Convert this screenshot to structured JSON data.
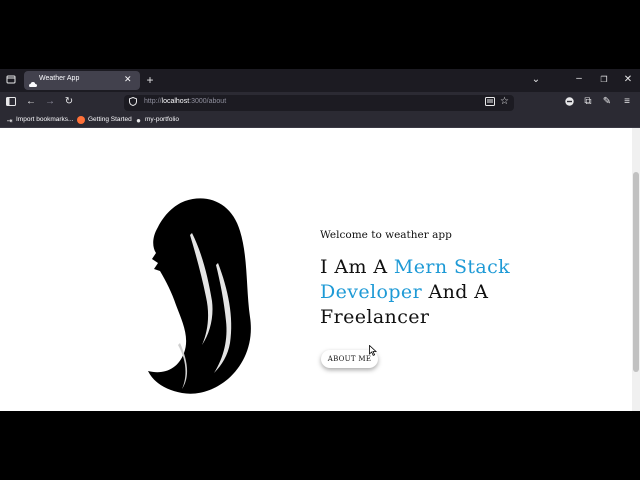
{
  "browser": {
    "tab_title": "Weather App",
    "url_prefix": "http://",
    "url_host": "localhost",
    "url_path": ":3000/about",
    "bookmarks": [
      {
        "label": "Import bookmarks..."
      },
      {
        "label": "Getting Started"
      },
      {
        "label": "my-portfolio"
      }
    ]
  },
  "page": {
    "welcome": "Welcome to weather app",
    "heading_part1": "I Am A ",
    "heading_accent": "Mern Stack Developer",
    "heading_part2": " And A Freelancer",
    "about_button": "ABOUT ME",
    "accent_color": "#1e9ad6"
  }
}
